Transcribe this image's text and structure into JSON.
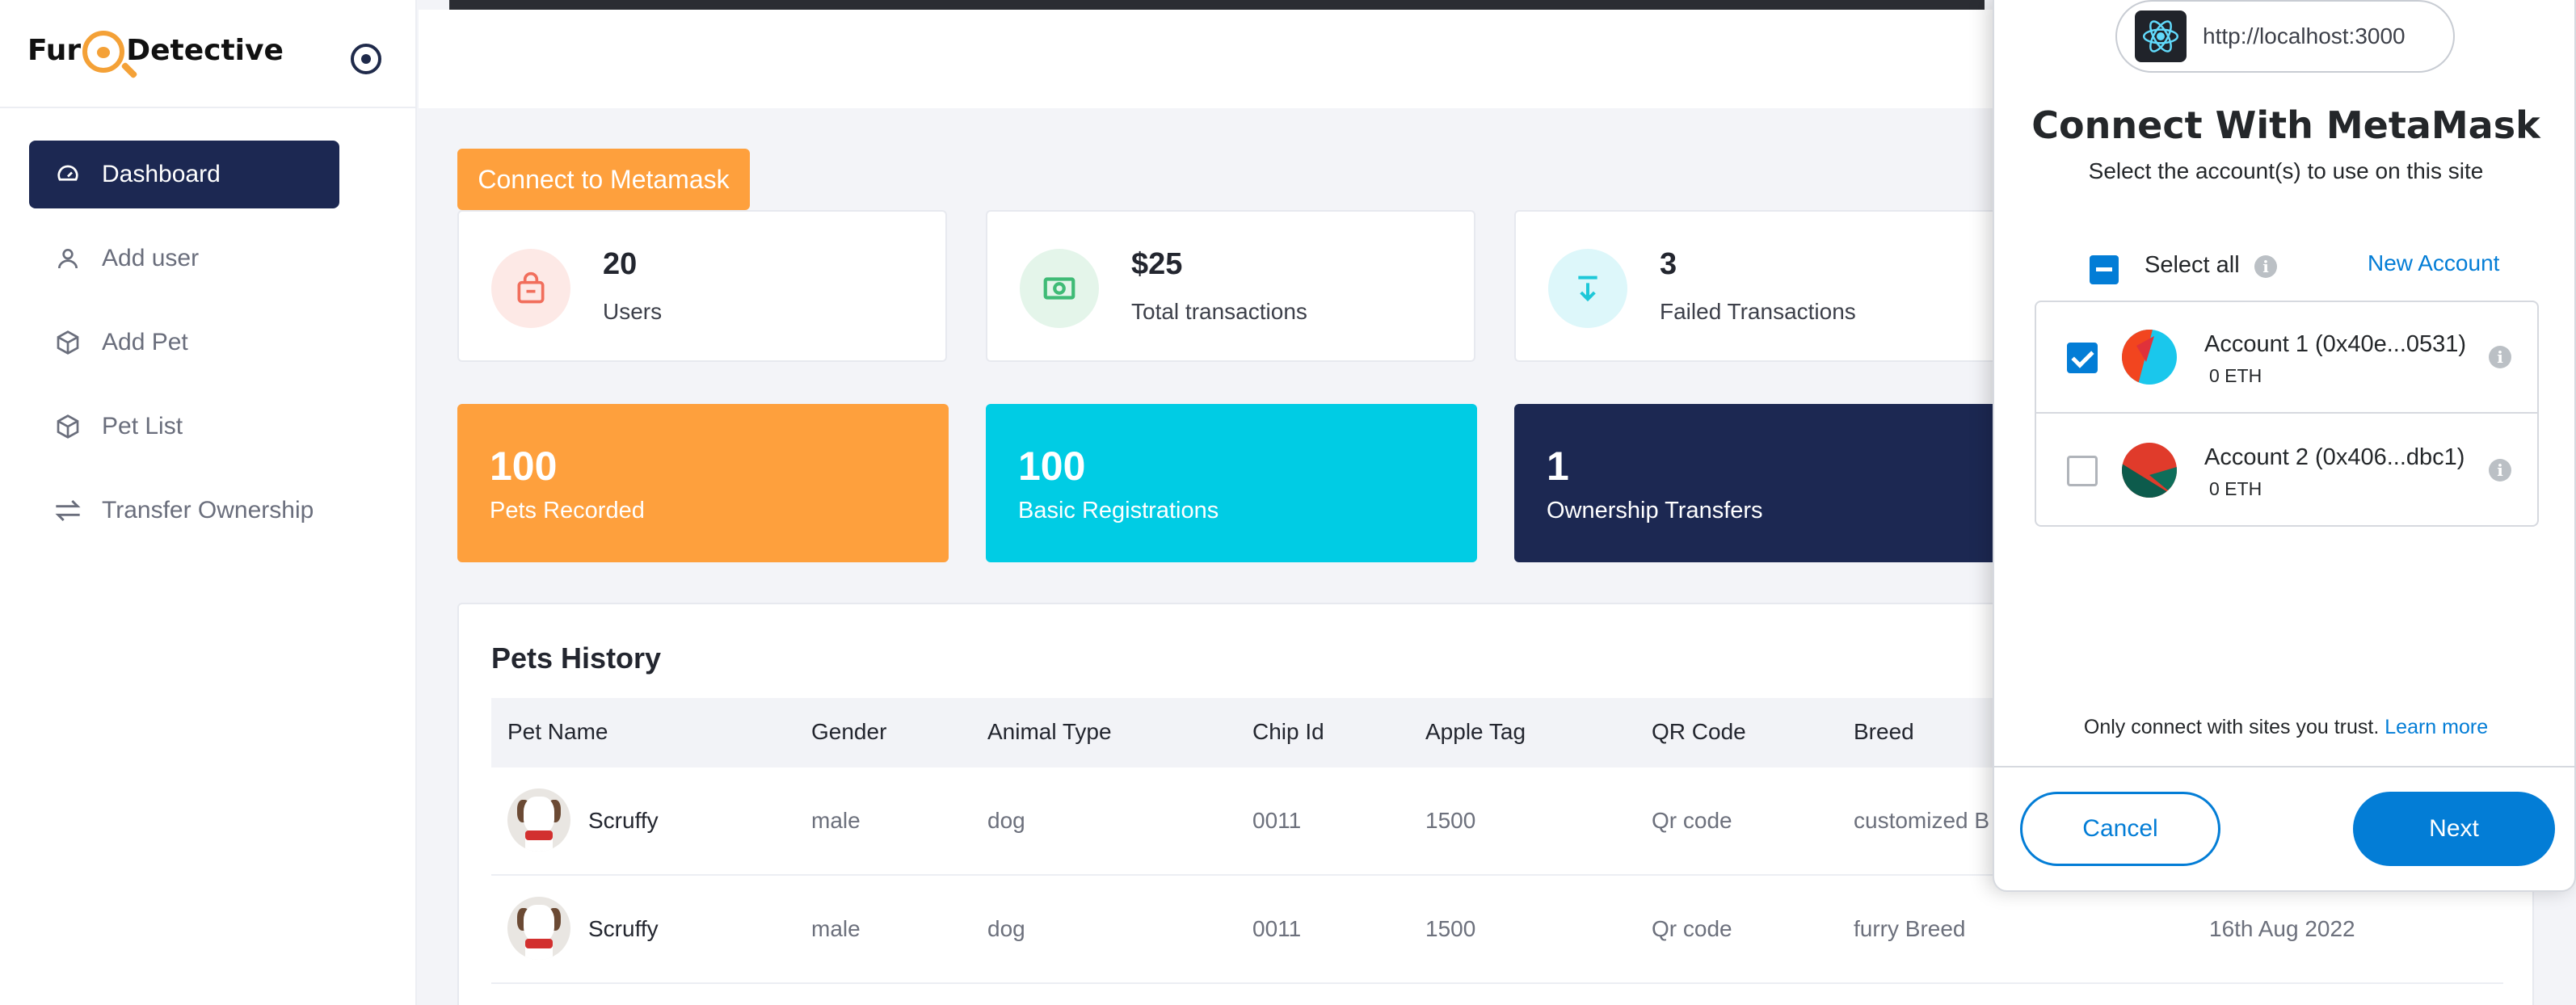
{
  "app": {
    "logo_part1": "Fur",
    "logo_part2": "Detective"
  },
  "sidebar": {
    "items": [
      {
        "label": "Dashboard",
        "icon": "gauge-icon",
        "active": true
      },
      {
        "label": "Add user",
        "icon": "user-icon"
      },
      {
        "label": "Add Pet",
        "icon": "box-icon"
      },
      {
        "label": "Pet List",
        "icon": "box-icon"
      },
      {
        "label": "Transfer Ownership",
        "icon": "transfer-arrows-icon"
      }
    ]
  },
  "main": {
    "connect_button": "Connect to Metamask",
    "stats": [
      {
        "value": "20",
        "label": "Users",
        "icon": "shopping-bag-icon",
        "color": "#f16e5c"
      },
      {
        "value": "$25",
        "label": "Total transactions",
        "icon": "cash-icon",
        "color": "#3fbb76"
      },
      {
        "value": "3",
        "label": "Failed Transactions",
        "icon": "download-arrow-icon",
        "color": "#1ec8d8"
      }
    ],
    "big_cards": [
      {
        "value": "100",
        "label": "Pets Recorded",
        "color": "#fea03d"
      },
      {
        "value": "100",
        "label": "Basic Registrations",
        "color": "#00cce4"
      },
      {
        "value": "1",
        "label": "Ownership Transfers",
        "color": "#1c2852"
      }
    ],
    "history": {
      "title": "Pets History",
      "columns": [
        "Pet Name",
        "Gender",
        "Animal Type",
        "Chip Id",
        "Apple Tag",
        "QR Code",
        "Breed"
      ],
      "rows": [
        {
          "name": "Scruffy",
          "gender": "male",
          "type": "dog",
          "chip": "0011",
          "apple": "1500",
          "qr": "Qr code",
          "breed": "customized B",
          "date": ""
        },
        {
          "name": "Scruffy",
          "gender": "male",
          "type": "dog",
          "chip": "0011",
          "apple": "1500",
          "qr": "Qr code",
          "breed": "furry Breed",
          "date": "16th Aug 2022"
        }
      ]
    }
  },
  "metamask": {
    "origin": "http://localhost:3000",
    "title": "Connect With MetaMask",
    "subtitle": "Select the account(s) to use on this site",
    "select_all": "Select all",
    "new_account": "New Account",
    "accounts": [
      {
        "name": "Account 1 (0x40e...0531)",
        "balance": "0 ETH",
        "checked": true
      },
      {
        "name": "Account 2 (0x406...dbc1)",
        "balance": "0 ETH",
        "checked": false
      }
    ],
    "footer_text": "Only connect with sites you trust.",
    "learn_more": "Learn more",
    "cancel": "Cancel",
    "next": "Next"
  }
}
